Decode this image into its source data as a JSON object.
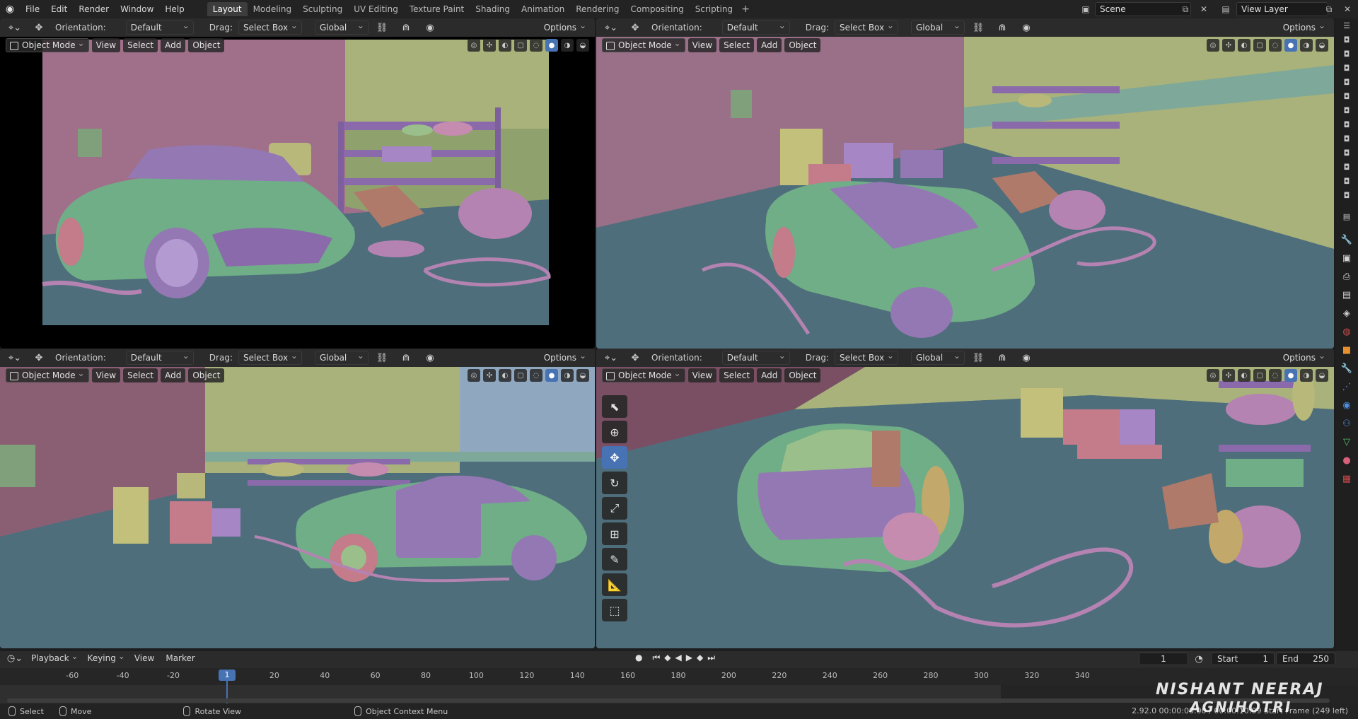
{
  "topbar": {
    "menus": [
      "File",
      "Edit",
      "Render",
      "Window",
      "Help"
    ],
    "workspaces": [
      "Layout",
      "Modeling",
      "Sculpting",
      "UV Editing",
      "Texture Paint",
      "Shading",
      "Animation",
      "Rendering",
      "Compositing",
      "Scripting"
    ],
    "active_workspace": "Layout",
    "add_workspace": "+",
    "scene": "Scene",
    "view_layer": "View Layer"
  },
  "viewport_header": {
    "orientation_label": "Orientation:",
    "orientation_value": "Default",
    "drag_label": "Drag:",
    "drag_value": "Select Box",
    "transform_space": "Global",
    "options": "Options"
  },
  "viewport_sub": {
    "mode": "Object Mode",
    "view": "View",
    "select": "Select",
    "add": "Add",
    "object": "Object"
  },
  "timeline": {
    "playback": "Playback",
    "keying": "Keying",
    "view": "View",
    "marker": "Marker",
    "current_frame": "1",
    "start_label": "Start",
    "start_value": "1",
    "end_label": "End",
    "end_value": "250",
    "ruler_ticks": [
      "-60",
      "-40",
      "-20",
      "20",
      "40",
      "60",
      "80",
      "100",
      "120",
      "140",
      "160",
      "180",
      "200",
      "220",
      "240",
      "260",
      "280",
      "300",
      "320",
      "340"
    ]
  },
  "status": {
    "select": "Select",
    "move": "Move",
    "rotate": "Rotate View",
    "context": "Object Context Menu",
    "version": "2.92.0   00:00:00:00 / 00:00:10:09     Start Frame (249 left)"
  },
  "watermark": {
    "line1": "NISHANT NEERAJ",
    "line2": "AGNIHOTRI"
  },
  "colors": {
    "accent": "#4772b3",
    "wall_pink": "#a0708a",
    "wall_green": "#a8b27a",
    "floor": "#4f6e7c",
    "car_green": "#6fae86",
    "car_purple": "#9478b4"
  }
}
